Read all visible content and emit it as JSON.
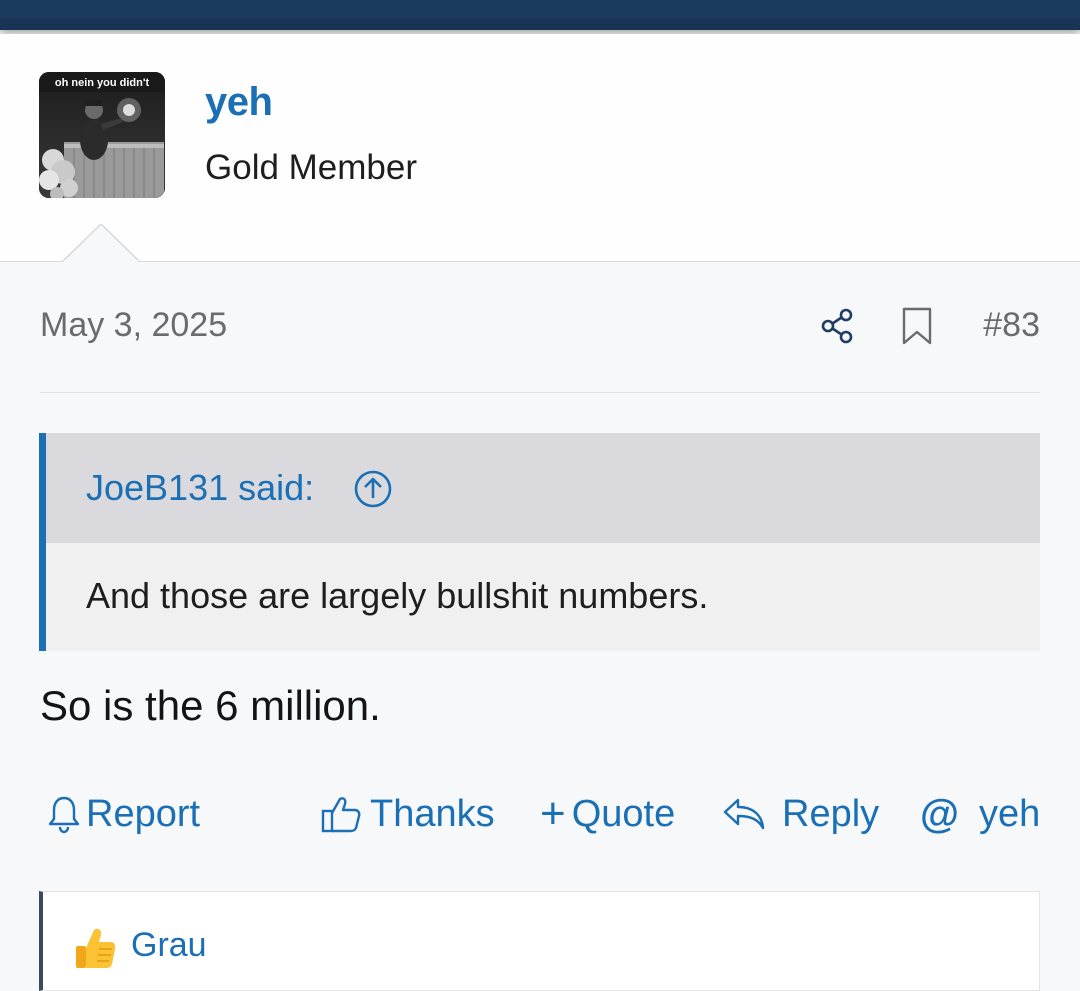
{
  "user": {
    "name": "yeh",
    "title": "Gold Member",
    "avatar_caption": "oh nein you didn't"
  },
  "post": {
    "date": "May 3, 2025",
    "number": "#83",
    "body": "So is the 6 million."
  },
  "quote": {
    "author_label": "JoeB131 said:",
    "text": "And those are largely bullshit numbers."
  },
  "actions": {
    "report": "Report",
    "thanks": "Thanks",
    "quote_plus": "+",
    "quote": "Quote",
    "reply": "Reply",
    "mention_at": "@",
    "mention_user": "yeh"
  },
  "reactions": {
    "user": "Grau"
  },
  "icons": {
    "share": "share-icon",
    "bookmark": "bookmark-icon",
    "quote_jump": "arrow-up-circle-icon",
    "report": "bell-icon",
    "thanks": "thumbs-up-icon",
    "reply": "reply-arrow-icon",
    "reaction": "thumbs-up-emoji-icon"
  },
  "colors": {
    "accent": "#1a6fb5",
    "topbar": "#183354",
    "quote_border": "#1a6fb5",
    "muted_text": "#6b6b6b"
  }
}
